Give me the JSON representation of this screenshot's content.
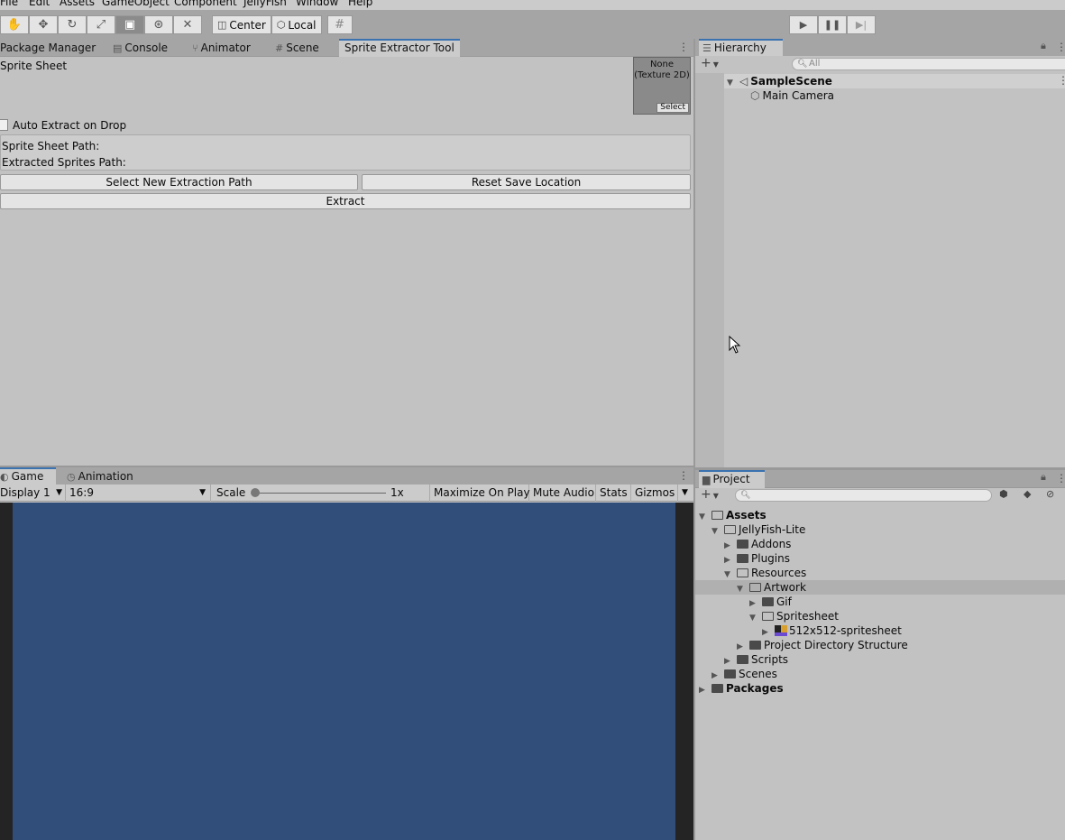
{
  "menu": [
    "File",
    "Edit",
    "Assets",
    "GameObject",
    "Component",
    "JellyFish",
    "Window",
    "Help"
  ],
  "toolbar": {
    "tools": [
      "hand-icon",
      "move-icon",
      "rotate-icon",
      "scale-icon",
      "rect-tool-icon",
      "transform-icon",
      "custom-tool-icon"
    ],
    "pivot_label": "Center",
    "space_label": "Local",
    "snap_icon": "grid-snap-icon",
    "play_icons": [
      "play-icon",
      "pause-icon",
      "step-icon"
    ]
  },
  "main_tabs": [
    "Package Manager",
    "Console",
    "Animator",
    "Scene",
    "Sprite Extractor Tool"
  ],
  "sprite_tool": {
    "sprite_sheet_label": "Sprite Sheet",
    "texture_none": "None",
    "texture_type": "(Texture 2D)",
    "select_label": "Select",
    "auto_extract_label": "Auto Extract on Drop",
    "sheet_path_label": "Sprite Sheet Path:",
    "extracted_path_label": "Extracted Sprites Path:",
    "select_path_button": "Select New Extraction Path",
    "reset_button": "Reset Save Location",
    "extract_button": "Extract"
  },
  "game_tabs": [
    "Game",
    "Animation"
  ],
  "game_toolbar": {
    "display": "Display 1",
    "aspect": "16:9",
    "scale_label": "Scale",
    "scale_value": "1x",
    "maximize": "Maximize On Play",
    "mute": "Mute Audio",
    "stats": "Stats",
    "gizmos": "Gizmos"
  },
  "hierarchy": {
    "tab": "Hierarchy",
    "search_placeholder": "All",
    "scene": "SampleScene",
    "items": [
      "Main Camera"
    ]
  },
  "project": {
    "tab": "Project",
    "tree": [
      {
        "label": "Assets",
        "bold": true
      },
      {
        "label": "JellyFish-Lite"
      },
      {
        "label": "Addons"
      },
      {
        "label": "Plugins"
      },
      {
        "label": "Resources"
      },
      {
        "label": "Artwork"
      },
      {
        "label": "Gif"
      },
      {
        "label": "Spritesheet"
      },
      {
        "label": "512x512-spritesheet"
      },
      {
        "label": "Project Directory Structure"
      },
      {
        "label": "Scripts"
      },
      {
        "label": "Scenes"
      },
      {
        "label": "Packages",
        "bold": true
      }
    ]
  },
  "colors": {
    "game_background": "#314d79",
    "active_tab_accent": "#3a72b0"
  }
}
